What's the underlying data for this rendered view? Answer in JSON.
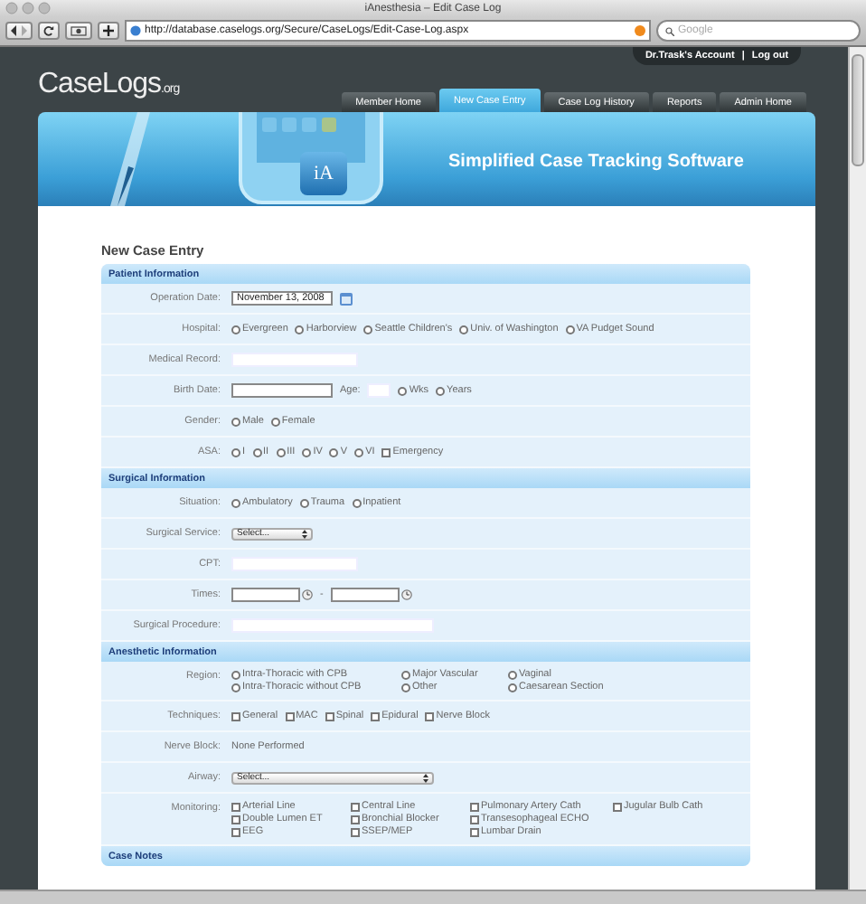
{
  "browser": {
    "title": "iAnesthesia – Edit Case Log",
    "url": "http://database.caselogs.org/Secure/CaseLogs/Edit-Case-Log.aspx",
    "search_placeholder": "Google"
  },
  "account": {
    "name": "Dr.Trask's Account",
    "separator": "|",
    "logout": "Log out"
  },
  "logo": {
    "text": "CaseLogs",
    "suffix": ".org"
  },
  "nav": [
    {
      "label": "Member Home",
      "selected": false
    },
    {
      "label": "New Case Entry",
      "selected": true
    },
    {
      "label": "Case Log History",
      "selected": false
    },
    {
      "label": "Reports",
      "selected": false
    },
    {
      "label": "Admin Home",
      "selected": false
    }
  ],
  "banner": {
    "tagline": "Simplified Case Tracking Software",
    "badge": "iA"
  },
  "heading": "New Case Entry",
  "sections": [
    {
      "title": "Patient Information",
      "rows": [
        {
          "label": "Operation Date:",
          "kind": "inline",
          "items": [
            {
              "kind": "date",
              "value": "November 13, 2008"
            }
          ]
        },
        {
          "label": "Hospital:",
          "kind": "inline",
          "items": [
            {
              "kind": "radio",
              "label": "Evergreen",
              "selected": false
            },
            {
              "kind": "radio",
              "label": "Harborview",
              "selected": false
            },
            {
              "kind": "radio",
              "label": "Seattle Children's",
              "selected": false
            },
            {
              "kind": "radio",
              "label": "Univ. of Washington",
              "selected": false
            },
            {
              "kind": "radio",
              "label": "VA Pudget Sound",
              "selected": false
            }
          ]
        },
        {
          "label": "Medical Record:",
          "kind": "inline",
          "items": [
            {
              "kind": "input"
            }
          ]
        },
        {
          "label": "Birth Date:",
          "kind": "inline",
          "items": [
            {
              "kind": "boxed_input"
            },
            {
              "kind": "text",
              "text": "Age:"
            },
            {
              "kind": "small_input"
            },
            {
              "kind": "radio",
              "label": "Wks",
              "selected": false
            },
            {
              "kind": "radio",
              "label": "Years",
              "selected": false
            }
          ]
        },
        {
          "label": "Gender:",
          "kind": "inline",
          "items": [
            {
              "kind": "radio",
              "label": "Male",
              "selected": false
            },
            {
              "kind": "radio",
              "label": "Female",
              "selected": false
            }
          ]
        },
        {
          "label": "ASA:",
          "kind": "inline",
          "items": [
            {
              "kind": "radio",
              "label": "I",
              "selected": false
            },
            {
              "kind": "radio",
              "label": "II",
              "selected": false
            },
            {
              "kind": "radio",
              "label": "III",
              "selected": false
            },
            {
              "kind": "radio",
              "label": "IV",
              "selected": false
            },
            {
              "kind": "radio",
              "label": "V",
              "selected": false
            },
            {
              "kind": "radio",
              "label": "VI",
              "selected": false
            },
            {
              "kind": "checkbox",
              "label": "Emergency",
              "checked": false
            }
          ]
        }
      ]
    },
    {
      "title": "Surgical Information",
      "rows": [
        {
          "label": "Situation:",
          "kind": "inline",
          "items": [
            {
              "kind": "radio",
              "label": "Ambulatory",
              "selected": false
            },
            {
              "kind": "radio",
              "label": "Trauma",
              "selected": false
            },
            {
              "kind": "radio",
              "label": "Inpatient",
              "selected": false
            }
          ]
        },
        {
          "label": "Surgical Service:",
          "kind": "inline",
          "items": [
            {
              "kind": "select",
              "value": "Select..."
            }
          ]
        },
        {
          "label": "CPT:",
          "kind": "inline",
          "items": [
            {
              "kind": "input"
            }
          ]
        },
        {
          "label": "Times:",
          "kind": "inline",
          "items": [
            {
              "kind": "time"
            },
            {
              "kind": "text",
              "text": "-"
            },
            {
              "kind": "time"
            }
          ]
        },
        {
          "label": "Surgical Procedure:",
          "kind": "inline",
          "items": [
            {
              "kind": "long_input"
            }
          ]
        }
      ]
    },
    {
      "title": "Anesthetic Information",
      "rows": [
        {
          "label": "Region:",
          "kind": "grid3",
          "items": [
            {
              "kind": "radio",
              "label": "Intra-Thoracic with CPB",
              "selected": false
            },
            {
              "kind": "radio",
              "label": "Intra-Thoracic without CPB",
              "selected": false
            },
            {
              "kind": "radio",
              "label": "Major Vascular",
              "selected": false
            },
            {
              "kind": "radio",
              "label": "Other",
              "selected": false
            },
            {
              "kind": "radio",
              "label": "Vaginal",
              "selected": false
            },
            {
              "kind": "radio",
              "label": "Caesarean Section",
              "selected": false
            }
          ]
        },
        {
          "label": "Techniques:",
          "kind": "inline",
          "items": [
            {
              "kind": "checkbox",
              "label": "General",
              "checked": false
            },
            {
              "kind": "checkbox",
              "label": "MAC",
              "checked": false
            },
            {
              "kind": "checkbox",
              "label": "Spinal",
              "checked": false
            },
            {
              "kind": "checkbox",
              "label": "Epidural",
              "checked": false
            },
            {
              "kind": "checkbox",
              "label": "Nerve Block",
              "checked": false
            }
          ]
        },
        {
          "label": "Nerve Block:",
          "kind": "inline",
          "items": [
            {
              "kind": "text",
              "text": "None Performed"
            }
          ]
        },
        {
          "label": "Airway:",
          "kind": "inline",
          "items": [
            {
              "kind": "long_select",
              "value": "Select..."
            }
          ]
        },
        {
          "label": "Monitoring:",
          "kind": "grid4",
          "items": [
            {
              "kind": "checkbox",
              "label": "Arterial Line",
              "checked": false
            },
            {
              "kind": "checkbox",
              "label": "Double Lumen ET",
              "checked": false
            },
            {
              "kind": "checkbox",
              "label": "EEG",
              "checked": false
            },
            {
              "kind": "checkbox",
              "label": "Central Line",
              "checked": false
            },
            {
              "kind": "checkbox",
              "label": "Bronchial Blocker",
              "checked": false
            },
            {
              "kind": "checkbox",
              "label": "SSEP/MEP",
              "checked": false
            },
            {
              "kind": "checkbox",
              "label": "Pulmonary Artery Cath",
              "checked": false
            },
            {
              "kind": "checkbox",
              "label": "Transesophageal ECHO",
              "checked": false
            },
            {
              "kind": "checkbox",
              "label": "Lumbar Drain",
              "checked": false
            },
            {
              "kind": "checkbox",
              "label": "Jugular Bulb Cath",
              "checked": false
            }
          ]
        }
      ]
    },
    {
      "title": "Case Notes"
    }
  ]
}
